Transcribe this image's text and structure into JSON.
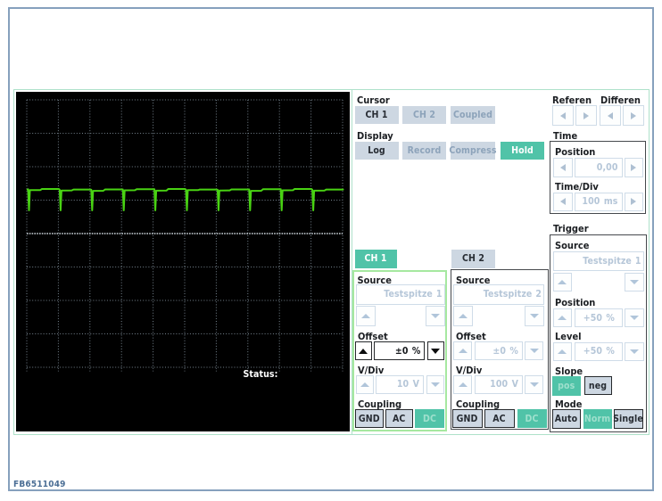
{
  "page": {
    "footer_id": "FB6511049",
    "colors": {
      "accent_teal": "#50c3a8",
      "button_bg": "#cdd7e2",
      "outer_border": "#86a0bd",
      "inner_border": "#aee1ca",
      "selected_panel_border": "#a6e8a0",
      "waveform_green": "#49d313"
    }
  },
  "scope": {
    "status_label": "Status:",
    "grid": {
      "columns": 10,
      "rows": 8
    },
    "waveform": {
      "type": "periodic-negative-spikes",
      "periods": 10,
      "baseline_div_from_top": 2.66,
      "spike_depth_div": 0.645,
      "description": "flat line with narrow downward spike each division"
    }
  },
  "cursor": {
    "label": "Cursor",
    "buttons": [
      {
        "label": "CH 1",
        "state": "enabled"
      },
      {
        "label": "CH 2",
        "state": "disabled"
      },
      {
        "label": "Coupled",
        "state": "disabled"
      }
    ]
  },
  "display": {
    "label": "Display",
    "buttons": [
      {
        "label": "Log",
        "state": "enabled"
      },
      {
        "label": "Record",
        "state": "disabled"
      },
      {
        "label": "Compress",
        "state": "disabled"
      },
      {
        "label": "Hold",
        "state": "active"
      }
    ]
  },
  "reference": {
    "label": "Referen"
  },
  "difference": {
    "label": "Differen"
  },
  "time": {
    "label": "Time",
    "position": {
      "label": "Position",
      "value": "0,00"
    },
    "timediv": {
      "label": "Time/Div",
      "value": "100 ms"
    }
  },
  "trigger": {
    "label": "Trigger",
    "source": {
      "label": "Source",
      "value": "Testspitze 1"
    },
    "position": {
      "label": "Position",
      "value": "+50 %"
    },
    "level": {
      "label": "Level",
      "value": "+50 %"
    },
    "slope": {
      "label": "Slope",
      "pos": "pos",
      "neg": "neg",
      "selected": "pos"
    },
    "mode": {
      "label": "Mode",
      "auto": "Auto",
      "norm": "Norm",
      "single": "Single",
      "selected": "Norm"
    }
  },
  "ch1": {
    "button": "CH 1",
    "state": "active",
    "source": {
      "label": "Source",
      "value": "Testspitze 1"
    },
    "offset": {
      "label": "Offset",
      "value": "±0 %"
    },
    "vdiv": {
      "label": "V/Div",
      "value": "10 V"
    },
    "coupling": {
      "label": "Coupling",
      "gnd": "GND",
      "ac": "AC",
      "dc": "DC",
      "selected": "DC"
    }
  },
  "ch2": {
    "button": "CH 2",
    "state": "inactive",
    "source": {
      "label": "Source",
      "value": "Testspitze 2"
    },
    "offset": {
      "label": "Offset",
      "value": "±0 %"
    },
    "vdiv": {
      "label": "V/Div",
      "value": "100 V"
    },
    "coupling": {
      "label": "Coupling",
      "gnd": "GND",
      "ac": "AC",
      "dc": "DC",
      "selected": "DC"
    }
  }
}
